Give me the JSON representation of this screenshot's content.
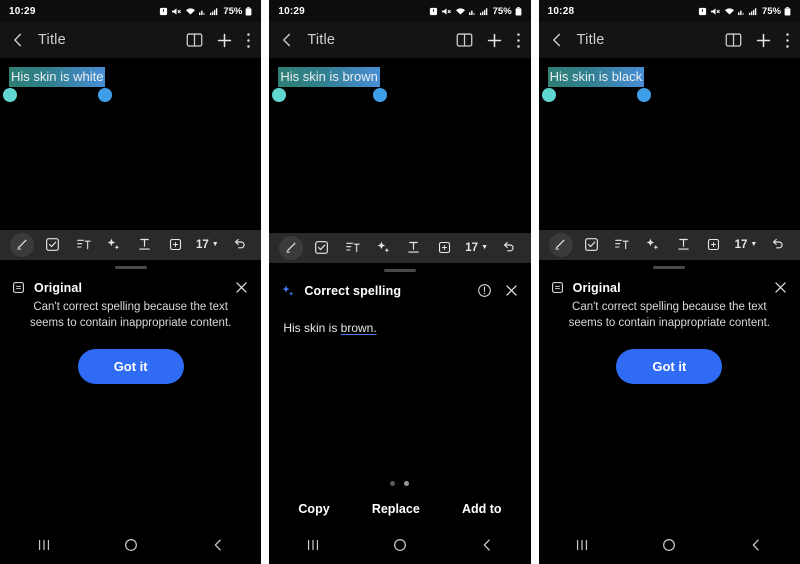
{
  "panels": [
    {
      "status": {
        "time": "10:29",
        "battery": "75%",
        "icons": [
          "alarm-icon",
          "mute-icon",
          "wifi-icon",
          "signal-secondary-icon",
          "signal-icon",
          "battery-icon"
        ]
      },
      "appbar": {
        "back": "back-arrow-icon",
        "title": "Title",
        "book": "book-icon",
        "add": "plus-icon",
        "more": "more-vertical-icon"
      },
      "note": {
        "selected_text": "His skin is white"
      },
      "toolbar": {
        "pen": "pen-icon",
        "checkbox": "checkbox-icon",
        "list": "list-format-icon",
        "ai": "sparkle-icon",
        "text": "text-format-icon",
        "frame": "insert-frame-icon",
        "font_size": "17",
        "undo": "undo-icon"
      },
      "sheet": {
        "type": "original",
        "icon": "document-icon",
        "title": "Original",
        "close": "close-icon",
        "message": "Can't correct spelling because the text seems to contain inappropriate content.",
        "primary_button": "Got it"
      },
      "nav": {
        "recents": "recents-icon",
        "home": "home-icon",
        "back": "back-chevron-icon"
      }
    },
    {
      "status": {
        "time": "10:29",
        "battery": "75%",
        "icons": [
          "alarm-icon",
          "mute-icon",
          "wifi-icon",
          "signal-secondary-icon",
          "signal-icon",
          "battery-icon"
        ]
      },
      "appbar": {
        "back": "back-arrow-icon",
        "title": "Title",
        "book": "book-icon",
        "add": "plus-icon",
        "more": "more-vertical-icon"
      },
      "note": {
        "selected_text": "His skin is brown"
      },
      "toolbar": {
        "pen": "pen-icon",
        "checkbox": "checkbox-icon",
        "list": "list-format-icon",
        "ai": "sparkle-icon",
        "text": "text-format-icon",
        "frame": "insert-frame-icon",
        "font_size": "17",
        "undo": "undo-icon"
      },
      "sheet": {
        "type": "correct-spelling",
        "icon": "sparkle-icon",
        "title": "Correct spelling",
        "info": "info-icon",
        "close": "close-icon",
        "result_prefix": "His skin is ",
        "result_correction": "brown.",
        "dots": [
          {
            "state": "inactive"
          },
          {
            "state": "active"
          }
        ],
        "actions": [
          "Copy",
          "Replace",
          "Add to"
        ]
      },
      "nav": {
        "recents": "recents-icon",
        "home": "home-icon",
        "back": "back-chevron-icon"
      }
    },
    {
      "status": {
        "time": "10:28",
        "battery": "75%",
        "icons": [
          "alarm-icon",
          "mute-icon",
          "wifi-icon",
          "signal-secondary-icon",
          "signal-icon",
          "battery-icon"
        ]
      },
      "appbar": {
        "back": "back-arrow-icon",
        "title": "Title",
        "book": "book-icon",
        "add": "plus-icon",
        "more": "more-vertical-icon"
      },
      "note": {
        "selected_text": "His skin is black"
      },
      "toolbar": {
        "pen": "pen-icon",
        "checkbox": "checkbox-icon",
        "list": "list-format-icon",
        "ai": "sparkle-icon",
        "text": "text-format-icon",
        "frame": "insert-frame-icon",
        "font_size": "17",
        "undo": "undo-icon"
      },
      "sheet": {
        "type": "original",
        "icon": "document-icon",
        "title": "Original",
        "close": "close-icon",
        "message": "Can't correct spelling because the text seems to contain inappropriate content.",
        "primary_button": "Got it"
      },
      "nav": {
        "recents": "recents-icon",
        "home": "home-icon",
        "back": "back-chevron-icon"
      }
    }
  ],
  "colors": {
    "accent_blue": "#2f6bf5",
    "selection_start": "#2f7f74",
    "selection_end": "#4a8fd6",
    "handle_left": "#5fd6cf",
    "handle_right": "#3e9ee8",
    "toolbar_bg": "#2a2a2a",
    "appbar_bg": "#141414",
    "page_bg": "#000000"
  }
}
